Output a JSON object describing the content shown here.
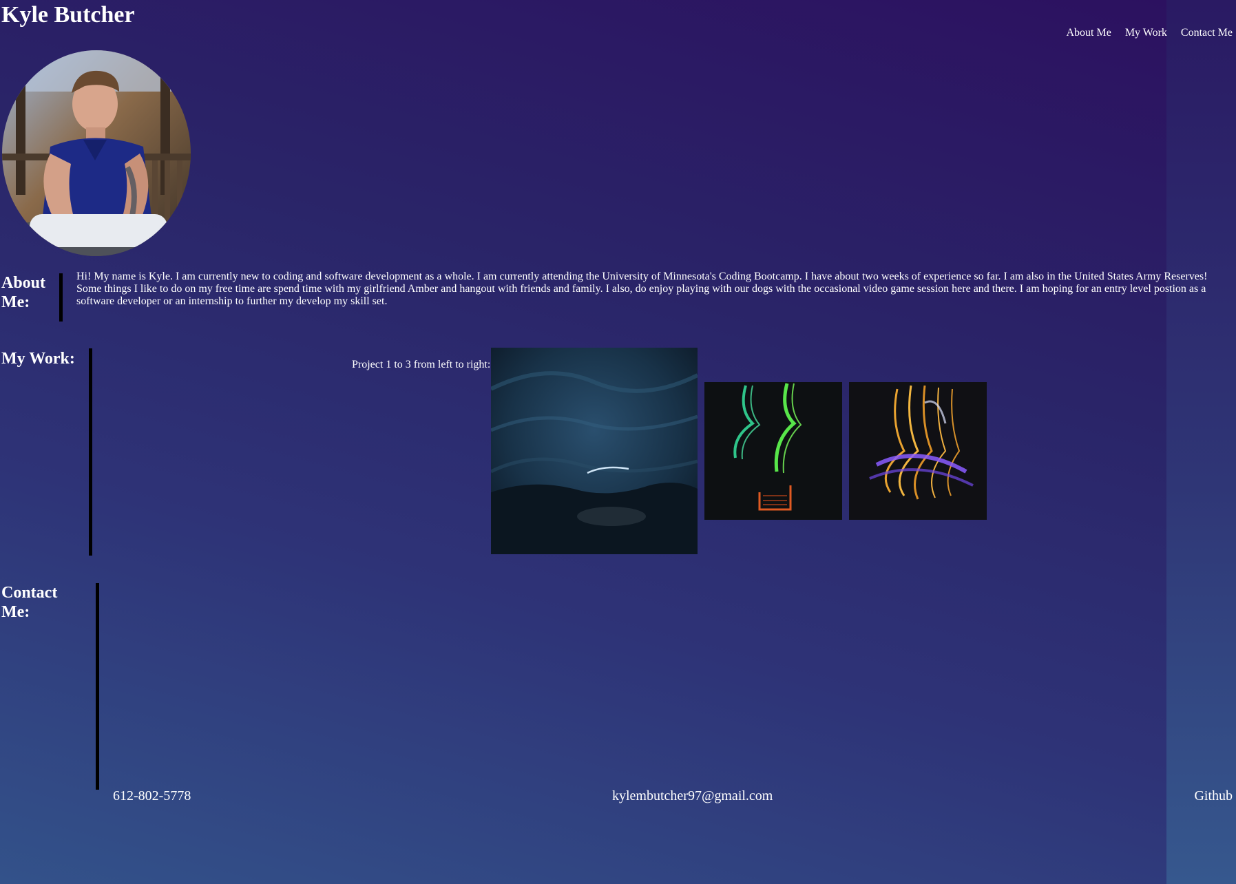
{
  "header": {
    "title": "Kyle Butcher"
  },
  "nav": {
    "items": [
      "About Me",
      "My Work",
      "Contact Me"
    ]
  },
  "about": {
    "heading": "About Me:",
    "text": "Hi! My name is Kyle. I am currently new to coding and software development as a whole. I am currently attending the University of Minnesota's Coding Bootcamp. I have about two weeks of experience so far. I am also in the United States Army Reserves! Some things I like to do on my free time are spend time with my girlfriend Amber and hangout with friends and family. I also, do enjoy playing with our dogs with the occasional video game session here and there. I am hoping for an entry level postion as a software developer or an internship to further my develop my skill set."
  },
  "work": {
    "heading": "My Work:",
    "caption": "Project 1 to 3 from left to right:"
  },
  "contact": {
    "heading": "Contact Me:",
    "phone": "612-802-5778",
    "email": "kylembutcher97@gmail.com",
    "github": "Github"
  },
  "colors": {
    "text": "#ffffff",
    "divider": "#000000",
    "background_top": "#2c1160",
    "background_bottom": "#33528a"
  }
}
